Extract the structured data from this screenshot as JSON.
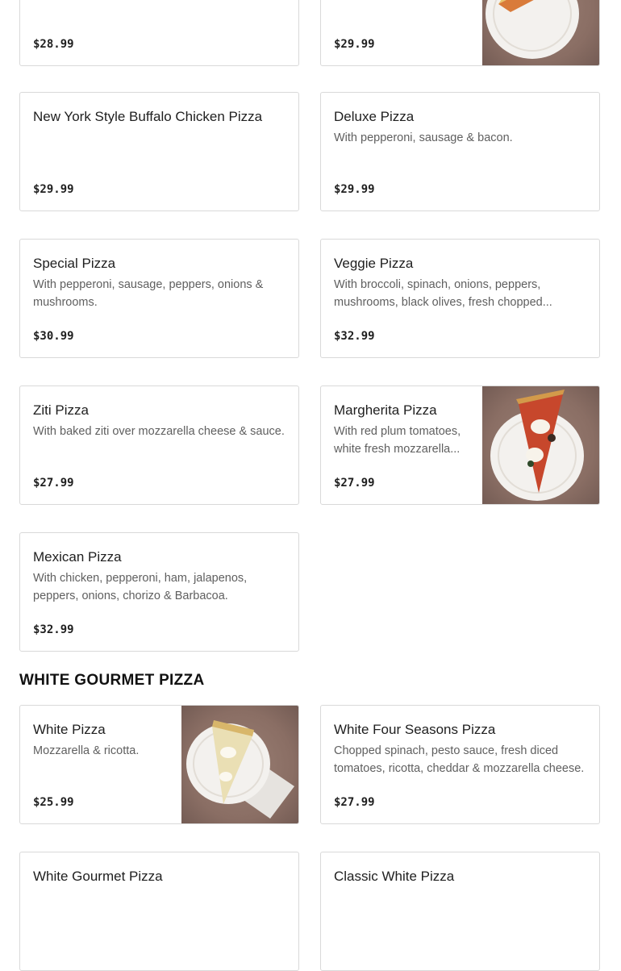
{
  "section_title": "WHITE GOURMET PIZZA",
  "items": [
    {
      "name": "",
      "description": "",
      "price": "$28.99"
    },
    {
      "name": "",
      "description": "",
      "price": "$29.99",
      "image": "pizza-slice-photo"
    },
    {
      "name": "New York Style Buffalo Chicken Pizza",
      "description": "",
      "price": "$29.99"
    },
    {
      "name": "Deluxe Pizza",
      "description": "With pepperoni, sausage & bacon.",
      "price": "$29.99"
    },
    {
      "name": "Special Pizza",
      "description": "With pepperoni, sausage, peppers, onions & mushrooms.",
      "price": "$30.99"
    },
    {
      "name": "Veggie Pizza",
      "description": "With broccoli, spinach, onions, peppers, mushrooms, black olives, fresh chopped...",
      "price": "$32.99"
    },
    {
      "name": "Ziti Pizza",
      "description": "With baked ziti over mozzarella cheese & sauce.",
      "price": "$27.99"
    },
    {
      "name": "Margherita Pizza",
      "description": "With red plum tomatoes, white fresh mozzarella...",
      "price": "$27.99",
      "image": "margherita-slice-photo"
    },
    {
      "name": "Mexican Pizza",
      "description": "With chicken, pepperoni, ham, jalapenos, peppers, onions, chorizo & Barbacoa.",
      "price": "$32.99"
    },
    {
      "name": "White Pizza",
      "description": "Mozzarella & ricotta.",
      "price": "$25.99",
      "image": "white-pizza-slice-photo"
    },
    {
      "name": "White Four Seasons Pizza",
      "description": "Chopped spinach, pesto sauce, fresh diced tomatoes, ricotta, cheddar & mozzarella cheese.",
      "price": "$27.99"
    },
    {
      "name": "White Gourmet Pizza",
      "description": "",
      "price": ""
    },
    {
      "name": "Classic White Pizza",
      "description": "",
      "price": ""
    }
  ],
  "colors": {
    "card_border": "#d9d9d9",
    "text": "#202020",
    "muted": "#5f5f5f",
    "photo_bg": "#8a7066"
  }
}
